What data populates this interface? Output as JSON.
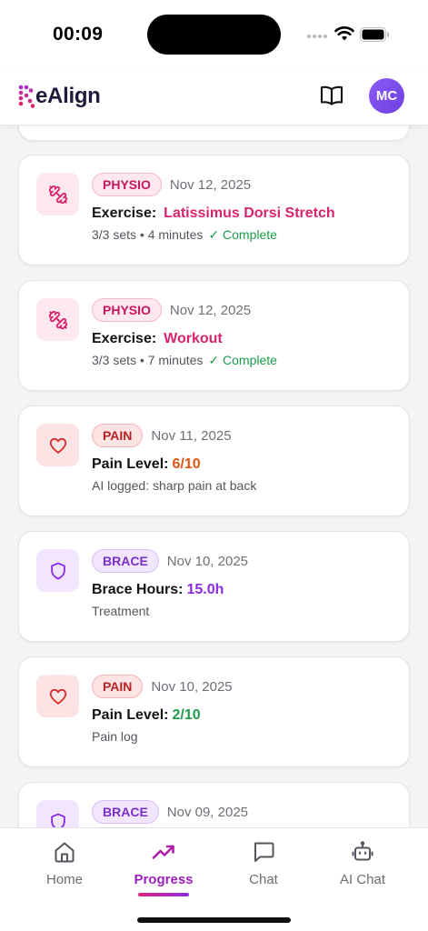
{
  "status_bar": {
    "time": "00:09"
  },
  "header": {
    "logo_text": "eAlign",
    "logo_mark": "R",
    "avatar_initials": "MC"
  },
  "entries": [
    {
      "type": "physio",
      "badge": "PHYSIO",
      "date": "Nov 12, 2025",
      "label": "Exercise:",
      "value": "Latissimus Dorsi Stretch",
      "detail": "3/3 sets • 4 minutes",
      "status": "✓ Complete",
      "icon": "dumbbell-icon"
    },
    {
      "type": "physio",
      "badge": "PHYSIO",
      "date": "Nov 12, 2025",
      "label": "Exercise:",
      "value": "Workout",
      "detail": "3/3 sets • 7 minutes",
      "status": "✓ Complete",
      "icon": "dumbbell-icon"
    },
    {
      "type": "pain",
      "badge": "PAIN",
      "date": "Nov 11, 2025",
      "label": "Pain Level:",
      "value": "6/10",
      "detail": "AI logged: sharp pain at back",
      "icon": "heart-icon"
    },
    {
      "type": "brace",
      "badge": "BRACE",
      "date": "Nov 10, 2025",
      "label": "Brace Hours:",
      "value": "15.0h",
      "detail": "Treatment",
      "icon": "shield-icon"
    },
    {
      "type": "pain",
      "badge": "PAIN",
      "date": "Nov 10, 2025",
      "label": "Pain Level:",
      "value": "2/10",
      "detail": "Pain log",
      "icon": "heart-icon"
    },
    {
      "type": "brace",
      "badge": "BRACE",
      "date": "Nov 09, 2025",
      "icon": "shield-icon"
    }
  ],
  "nav": {
    "items": [
      {
        "label": "Home",
        "icon": "home-icon"
      },
      {
        "label": "Progress",
        "icon": "trending-up-icon",
        "active": true
      },
      {
        "label": "Chat",
        "icon": "chat-bubble-icon"
      },
      {
        "label": "AI Chat",
        "icon": "robot-icon"
      }
    ]
  },
  "colors": {
    "accent_pink": "#d6246e",
    "accent_purple": "#8a2be2",
    "pain_orange": "#e0560f",
    "success_green": "#1e9c4a",
    "avatar_bg": "#7c4dea"
  }
}
